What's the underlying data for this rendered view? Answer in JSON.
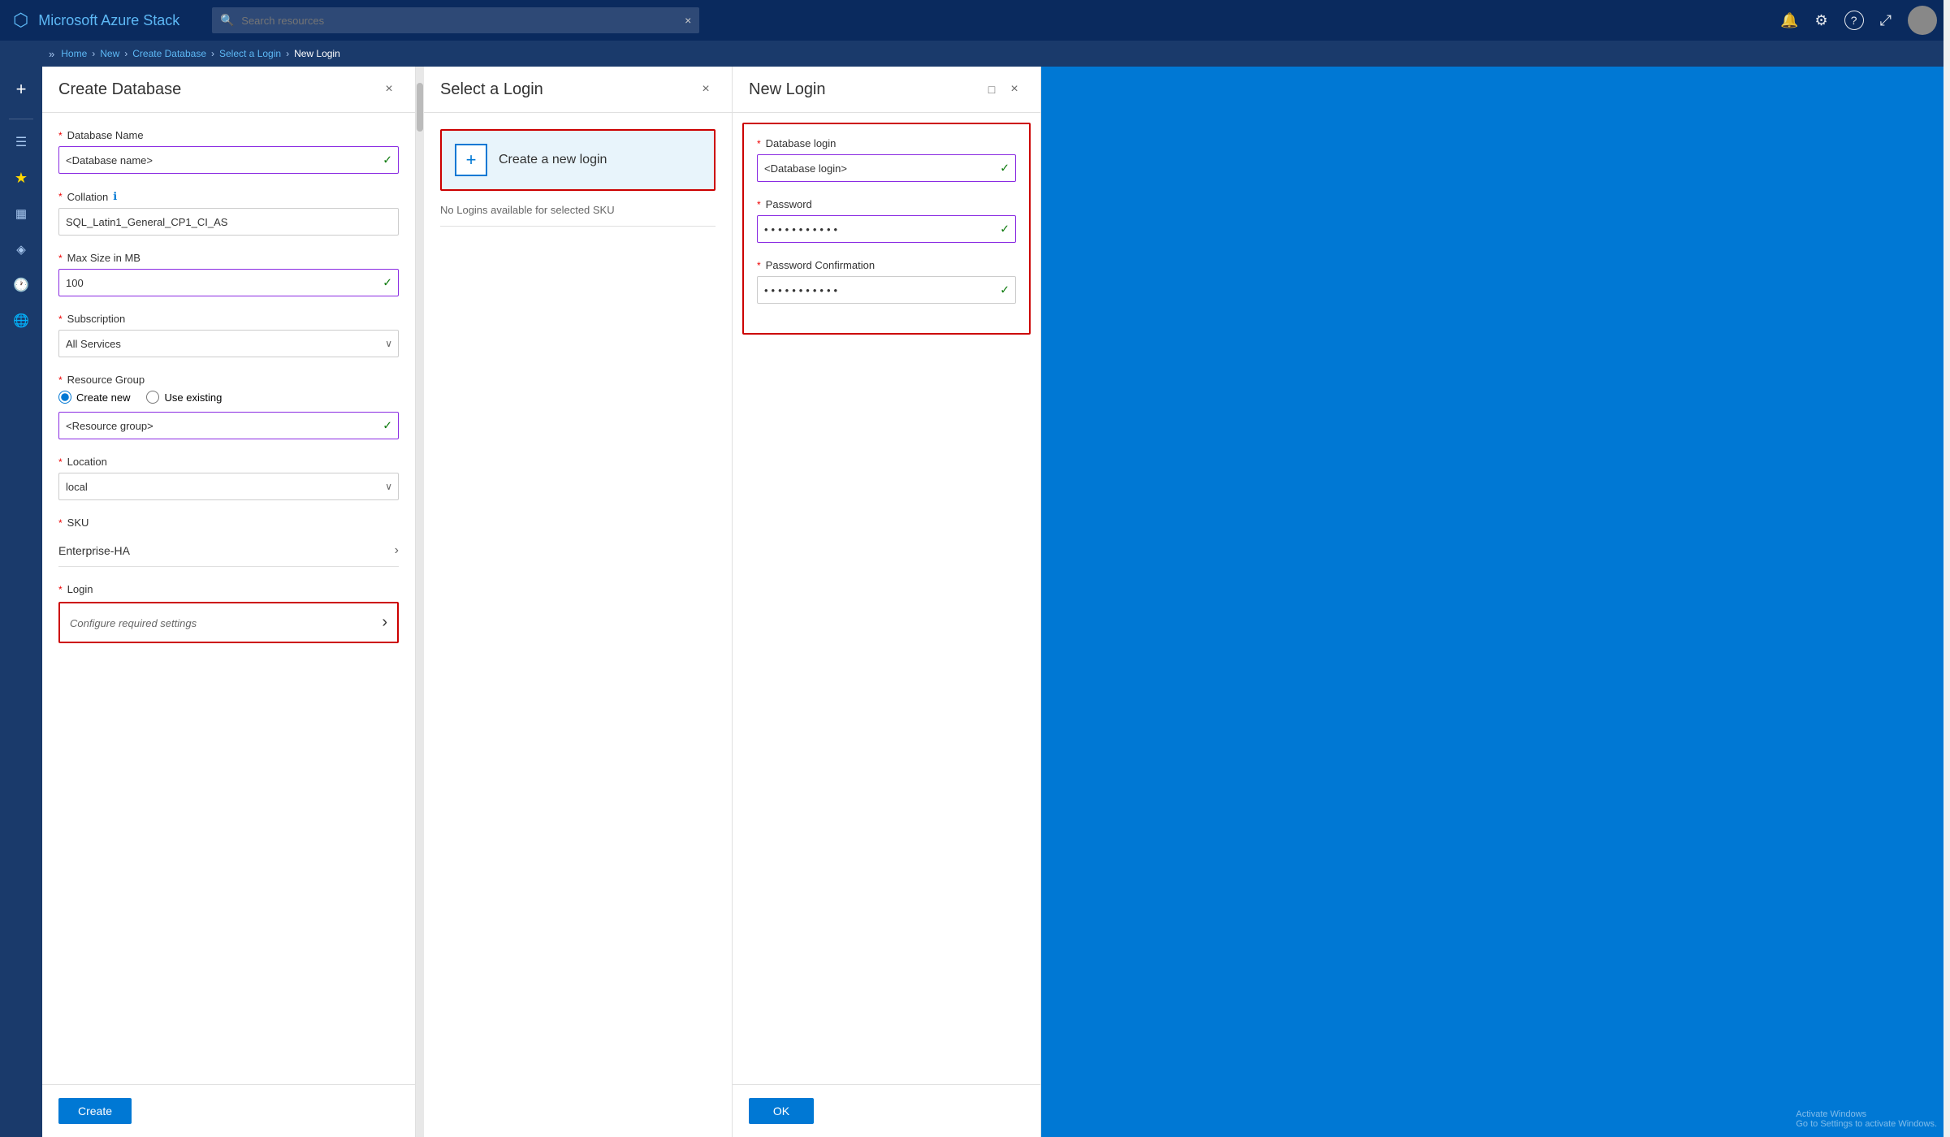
{
  "app": {
    "title": "Microsoft Azure Stack"
  },
  "topnav": {
    "search_placeholder": "Search resources",
    "search_clear_icon": "×"
  },
  "breadcrumb": {
    "items": [
      "Home",
      "New",
      "Create Database",
      "Select a Login",
      "New Login"
    ]
  },
  "sidebar": {
    "icons": [
      "+",
      "≡",
      "★",
      "▦",
      "◈",
      "🕐",
      "🌐"
    ]
  },
  "panel_create_db": {
    "title": "Create Database",
    "fields": {
      "database_name_label": "Database Name",
      "database_name_value": "<Database name>",
      "collation_label": "Collation",
      "collation_info": "ℹ",
      "collation_value": "SQL_Latin1_General_CP1_CI_AS",
      "max_size_label": "Max Size in MB",
      "max_size_value": "100",
      "subscription_label": "Subscription",
      "subscription_value": "All Services",
      "resource_group_label": "Resource Group",
      "radio_create_new": "Create new",
      "radio_use_existing": "Use existing",
      "resource_group_value": "<Resource group>",
      "location_label": "Location",
      "location_value": "local",
      "sku_label": "SKU",
      "sku_value": "Enterprise-HA",
      "login_label": "Login",
      "login_placeholder": "Configure required settings"
    },
    "create_button": "Create"
  },
  "panel_select_login": {
    "title": "Select a Login",
    "create_new_card": {
      "plus_icon": "+",
      "label": "Create a new login"
    },
    "no_logins_text": "No Logins available for selected SKU"
  },
  "panel_new_login": {
    "title": "New Login",
    "fields": {
      "db_login_label": "Database login",
      "db_login_value": "<Database login>",
      "password_label": "Password",
      "password_value": "••••••••••••",
      "password_confirm_label": "Password Confirmation",
      "password_confirm_value": "••••••••••••"
    },
    "ok_button": "OK"
  },
  "icons": {
    "bell": "🔔",
    "gear": "⚙",
    "question": "?",
    "feedback": "↗",
    "check": "✓",
    "chevron_right": "›",
    "chevron_down": "∨",
    "close": "×",
    "maximize": "□"
  }
}
